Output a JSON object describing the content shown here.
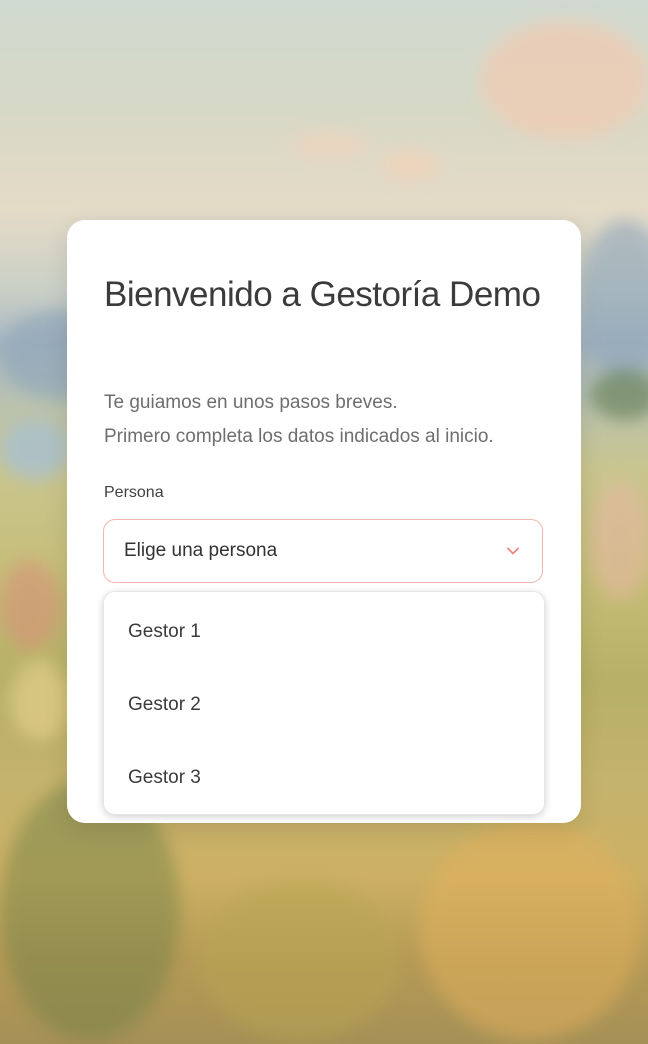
{
  "welcome": {
    "title": "Bienvenido a Gestoría Demo",
    "subtitle_line1": "Te guiamos en unos pasos breves.",
    "subtitle_line2": "Primero completa los datos indicados al inicio."
  },
  "form": {
    "persona_label": "Persona",
    "select_value": "Elige una persona",
    "select_icon": "chevron-down-icon",
    "options": [
      "Gestor 1",
      "Gestor 2",
      "Gestor 3"
    ]
  },
  "colors": {
    "accent": "#f2b6ae",
    "chevron": "#e9897c",
    "card": "#ffffff",
    "text_primary": "#3b3b3b",
    "text_secondary": "#6e6e6e"
  }
}
